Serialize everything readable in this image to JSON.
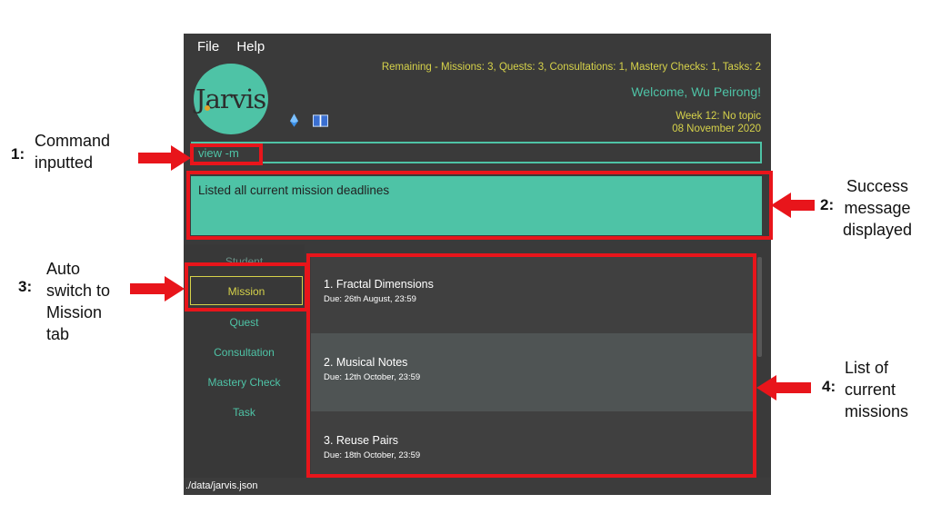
{
  "menu": {
    "file": "File",
    "help": "Help"
  },
  "logo": {
    "text": "Jarvis"
  },
  "header": {
    "remaining": "Remaining - Missions: 3, Quests: 3, Consultations: 1, Mastery Checks: 1, Tasks: 2",
    "welcome": "Welcome, Wu Peirong!",
    "week": "Week 12: No topic",
    "date": "08 November 2020"
  },
  "command": {
    "value": "view -m"
  },
  "result": {
    "message": "Listed all current mission deadlines"
  },
  "tabs": [
    {
      "label": "Student"
    },
    {
      "label": "Mission"
    },
    {
      "label": "Quest"
    },
    {
      "label": "Consultation"
    },
    {
      "label": "Mastery Check"
    },
    {
      "label": "Task"
    }
  ],
  "missions": [
    {
      "title": "1.  Fractal Dimensions",
      "due": "Due: 26th August, 23:59"
    },
    {
      "title": "2.  Musical Notes",
      "due": "Due: 12th October, 23:59"
    },
    {
      "title": "3.  Reuse Pairs",
      "due": "Due: 18th October, 23:59"
    }
  ],
  "status": {
    "path": "./data/jarvis.json"
  },
  "annotations": [
    {
      "num": "1:",
      "lines": [
        "Command",
        "inputted"
      ]
    },
    {
      "num": "2:",
      "lines": [
        "Success",
        "message",
        "displayed"
      ]
    },
    {
      "num": "3:",
      "lines": [
        "Auto",
        "switch to",
        "Mission",
        "tab"
      ]
    },
    {
      "num": "4:",
      "lines": [
        "List of",
        "current",
        "missions"
      ]
    }
  ],
  "colors": {
    "accent": "#4ec3a6",
    "highlight": "#d6d24a",
    "annotation_red": "#e8151b"
  }
}
